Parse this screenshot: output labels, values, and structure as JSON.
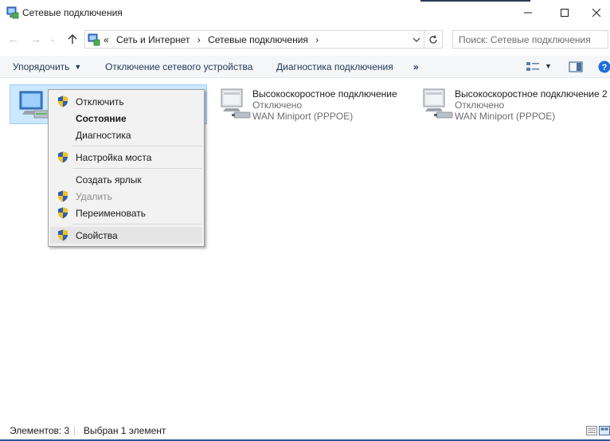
{
  "window": {
    "title": "Сетевые подключения"
  },
  "navigation": {
    "breadcrumb_prefix": "«",
    "breadcrumbs": [
      "Сеть и Интернет",
      "Сетевые подключения"
    ],
    "search_placeholder": "Поиск: Сетевые подключения"
  },
  "commandbar": {
    "organize": "Упорядочить",
    "disconnect": "Отключение сетевого устройства",
    "diagnose": "Диагностика подключения",
    "more": "»"
  },
  "connections": [
    {
      "name": "",
      "status": "",
      "device": "",
      "selected": true
    },
    {
      "name": "Высокоскоростное подключение",
      "status": "Отключено",
      "device": "WAN Miniport (PPPOE)",
      "selected": false
    },
    {
      "name": "Высокоскоростное подключение 2",
      "status": "Отключено",
      "device": "WAN Miniport (PPPOE)",
      "selected": false
    }
  ],
  "context_menu": {
    "items": [
      {
        "label": "Отключить",
        "shield": true,
        "bold": false,
        "disabled": false
      },
      {
        "label": "Состояние",
        "shield": false,
        "bold": true,
        "disabled": false
      },
      {
        "label": "Диагностика",
        "shield": false,
        "bold": false,
        "disabled": false
      },
      {
        "label": "Настройка моста",
        "shield": true,
        "bold": false,
        "disabled": false
      },
      {
        "label": "Создать ярлык",
        "shield": false,
        "bold": false,
        "disabled": false
      },
      {
        "label": "Удалить",
        "shield": true,
        "bold": false,
        "disabled": true
      },
      {
        "label": "Переименовать",
        "shield": true,
        "bold": false,
        "disabled": false
      },
      {
        "label": "Свойства",
        "shield": true,
        "bold": false,
        "disabled": false,
        "highlighted": true
      }
    ]
  },
  "statusbar": {
    "count": "Элементов: 3",
    "selection": "Выбран 1 элемент"
  },
  "colors": {
    "selection_bg": "#cce8ff",
    "selection_border": "#99d1ff",
    "command_text": "#1e395b",
    "accent": "#2b579a"
  }
}
